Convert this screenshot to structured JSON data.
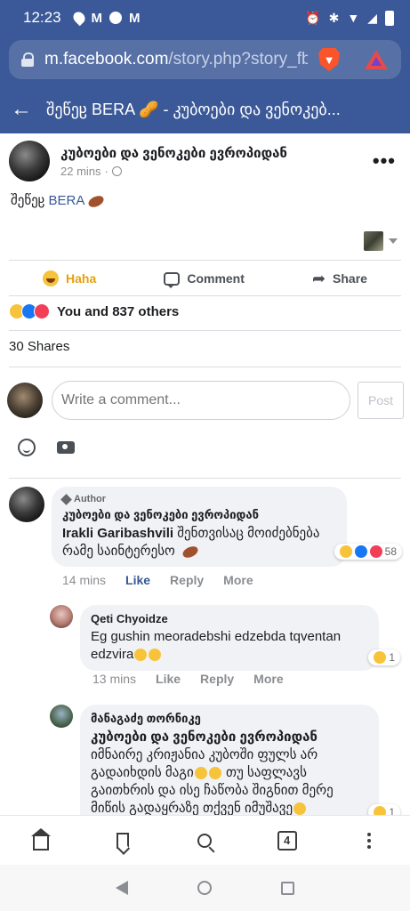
{
  "status": {
    "time": "12:23"
  },
  "browser": {
    "url_host": "m.facebook.com",
    "url_path": "/story.php?story_fb"
  },
  "nav": {
    "title": "შეწეჸ BERA 🥜 - კუბოები და ვენოკებ..."
  },
  "post": {
    "page_name": "კუბოები და ვენოკები ევროპიდან",
    "time": "22 mins",
    "text_prefix": "შეწეჸ ",
    "text_link": "BERA"
  },
  "actions": {
    "haha": "Haha",
    "comment": "Comment",
    "share": "Share"
  },
  "reactions_summary": "You and 837 others",
  "shares": "30 Shares",
  "composer": {
    "placeholder": "Write a comment...",
    "post_label": "Post"
  },
  "comments": [
    {
      "author_tag": "Author",
      "name": "კუბოები და ვენოკები ევროპიდან",
      "mention": "Irakli Garibashvili",
      "text": " შენთვისაც მოიძებნება რამე საინტერესო",
      "reaction_count": "58",
      "time": "14 mins",
      "like": "Like",
      "reply": "Reply",
      "more": "More"
    },
    {
      "name": "Qeti Chyoidze",
      "text": "Eg gushin meoradebshi edzebda tqventan edzvira",
      "reaction_count": "1",
      "time": "13 mins",
      "like": "Like",
      "reply": "Reply",
      "more": "More"
    },
    {
      "name": "მანაგაძე თორნიკე",
      "mention": "კუბოები და ვენოკები ევროპიდან",
      "text_a": "იმნაირე კრიჟანია კუბოში ფულს არ გადაიხდის მაგი",
      "text_b": " თუ საფლავს გაითხრის და ისე ჩაწობა შიგნით მერე მიწის გადაყრაზე თქვენ იმუშავე",
      "reaction_count": "1"
    }
  ],
  "bottom_bar": {
    "tab_count": "4"
  }
}
